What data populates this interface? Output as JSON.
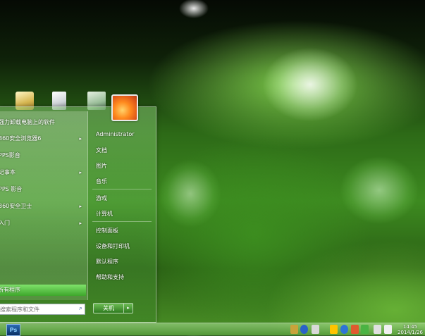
{
  "desktop": {
    "quick_icons": [
      "folder-icon",
      "documents-icon",
      "pictures-icon"
    ]
  },
  "start_menu": {
    "programs": [
      {
        "label": "强力卸载电脑上的软件",
        "has_arrow": false
      },
      {
        "label": "360安全浏览器6",
        "has_arrow": true
      },
      {
        "label": "PPS影音",
        "has_arrow": false
      },
      {
        "label": "记事本",
        "has_arrow": true
      },
      {
        "label": "PPS 影音",
        "has_arrow": false
      },
      {
        "label": "360安全卫士",
        "has_arrow": true
      },
      {
        "label": "入门",
        "has_arrow": true
      }
    ],
    "all_programs": "所有程序",
    "search_placeholder": "搜索程序和文件",
    "right_items": {
      "user": "Administrator",
      "documents": "文档",
      "pictures": "图片",
      "music": "音乐",
      "games": "游戏",
      "computer": "计算机",
      "control_panel": "控制面板",
      "devices": "设备和打印机",
      "default_programs": "默认程序",
      "help": "帮助和支持"
    },
    "shutdown": "关机",
    "arrow": "▸",
    "submenu_arrow": "▸"
  },
  "taskbar": {
    "ps_label": "Ps",
    "time": "14:45",
    "date": "2014/1/26"
  }
}
